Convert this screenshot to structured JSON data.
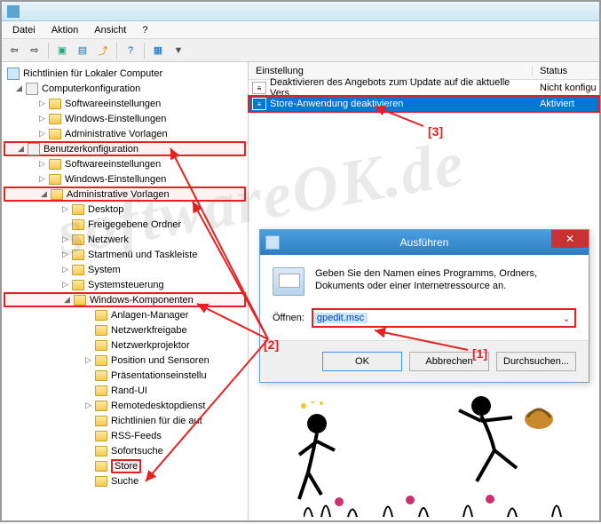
{
  "window": {
    "title": " "
  },
  "menu": {
    "file": "Datei",
    "action": "Aktion",
    "view": "Ansicht",
    "help": "?"
  },
  "tree": {
    "root": "Richtlinien für Lokaler Computer",
    "compconf": "Computerkonfiguration",
    "sw1": "Softwareeinstellungen",
    "win1": "Windows-Einstellungen",
    "adm1": "Administrative Vorlagen",
    "userconf": "Benutzerkonfiguration",
    "sw2": "Softwareeinstellungen",
    "win2": "Windows-Einstellungen",
    "adm2": "Administrative Vorlagen",
    "desktop": "Desktop",
    "shared": "Freigegebene Ordner",
    "network": "Netzwerk",
    "startmenu": "Startmenü und Taskleiste",
    "system": "System",
    "controlpanel": "Systemsteuerung",
    "wincomp": "Windows-Komponenten",
    "anlagen": "Anlagen-Manager",
    "netzfrei": "Netzwerkfreigabe",
    "netzproj": "Netzwerkprojektor",
    "position": "Position und Sensoren",
    "present": "Präsentationseinstellu",
    "randui": "Rand-UI",
    "rdp": "Remotedesktopdienst",
    "richt": "Richtlinien für die aut",
    "rss": "RSS-Feeds",
    "sofort": "Sofortsuche",
    "store": "Store",
    "suche": "Suche"
  },
  "list": {
    "col_setting": "Einstellung",
    "col_status": "Status",
    "row1_text": "Deaktivieren des Angebots zum Update auf die aktuelle Vers...",
    "row1_status": "Nicht konfigu",
    "row2_text": "Store-Anwendung deaktivieren",
    "row2_status": "Aktiviert"
  },
  "run": {
    "title": "Ausführen",
    "desc": "Geben Sie den Namen eines Programms, Ordners, Dokuments oder einer Internetressource an.",
    "label": "Öffnen:",
    "value": "gpedit.msc",
    "ok": "OK",
    "cancel": "Abbrechen",
    "browse": "Durchsuchen..."
  },
  "annotations": {
    "a1": "[1]",
    "a2": "[2]",
    "a3": "[3]"
  },
  "watermark": "softwareOK.de"
}
